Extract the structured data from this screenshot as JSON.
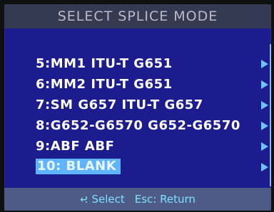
{
  "title": "SELECT SPLICE MODE",
  "menu": {
    "items": [
      {
        "label": "5:MM1 ITU-T G651"
      },
      {
        "label": "6:MM2 ITU-T G651"
      },
      {
        "label": "7:SM G657 ITU-T G657"
      },
      {
        "label": "8:G652-G6570 G652-G6570"
      },
      {
        "label": "9:ABF ABF"
      },
      {
        "label": "10: BLANK",
        "selected": true
      }
    ]
  },
  "status": {
    "enter_icon": "enter-icon",
    "select_label": ": Select",
    "esc_label": "Esc: Return"
  },
  "colors": {
    "background": "#1d1c8f",
    "title_bar": "#343a52",
    "status_bar": "#4e5b86",
    "highlight": "#5fb4ff",
    "arrow": "#6ec3ff"
  }
}
